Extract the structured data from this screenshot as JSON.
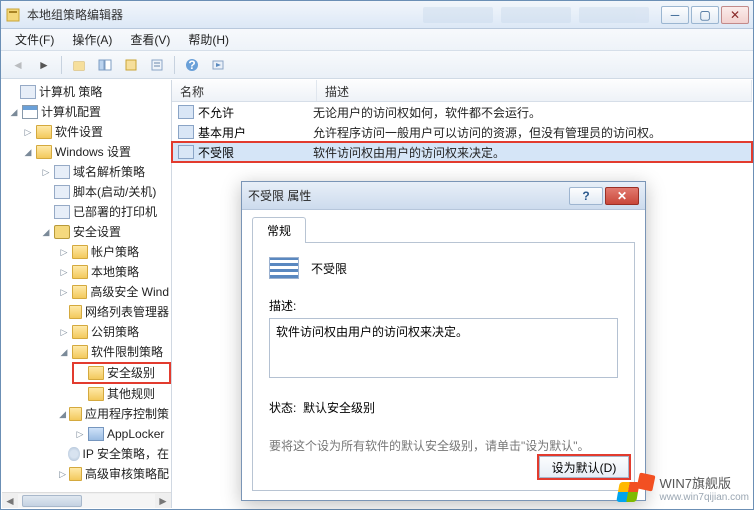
{
  "window": {
    "title": "本地组策略编辑器"
  },
  "menubar": [
    {
      "label": "文件(F)"
    },
    {
      "label": "操作(A)"
    },
    {
      "label": "查看(V)"
    },
    {
      "label": "帮助(H)"
    }
  ],
  "tree": {
    "root": "计算机 策略",
    "config": "计算机配置",
    "software": "软件设置",
    "windows_settings": "Windows 设置",
    "dns": "域名解析策略",
    "scripts": "脚本(启动/关机)",
    "printers": "已部署的打印机",
    "security": "安全设置",
    "account": "帐户策略",
    "local": "本地策略",
    "adv_win": "高级安全 Wind",
    "netlist": "网络列表管理器",
    "pubkey": "公钥策略",
    "srp": "软件限制策略",
    "sec_level": "安全级别",
    "other_rules": "其他规则",
    "appctrl": "应用程序控制策",
    "applocker": "AppLocker",
    "ipsec": "IP 安全策略，在",
    "audit": "高级审核策略配"
  },
  "list": {
    "columns": {
      "name": "名称",
      "desc": "描述"
    },
    "rows": [
      {
        "name": "不允许",
        "desc": "无论用户的访问权如何，软件都不会运行。"
      },
      {
        "name": "基本用户",
        "desc": "允许程序访问一般用户可以访问的资源，但没有管理员的访问权。"
      },
      {
        "name": "不受限",
        "desc": "软件访问权由用户的访问权来决定。"
      }
    ]
  },
  "dialog": {
    "title": "不受限 属性",
    "tab": "常规",
    "name": "不受限",
    "desc_label": "描述:",
    "desc_value": "软件访问权由用户的访问权来决定。",
    "status_label": "状态:",
    "status_value": "默认安全级别",
    "hint": "要将这个设为所有软件的默认安全级别，请单击\"设为默认\"。",
    "set_default": "设为默认(D)"
  },
  "watermark": {
    "text": "WIN7旗舰版",
    "url": "www.win7qijian.com"
  }
}
